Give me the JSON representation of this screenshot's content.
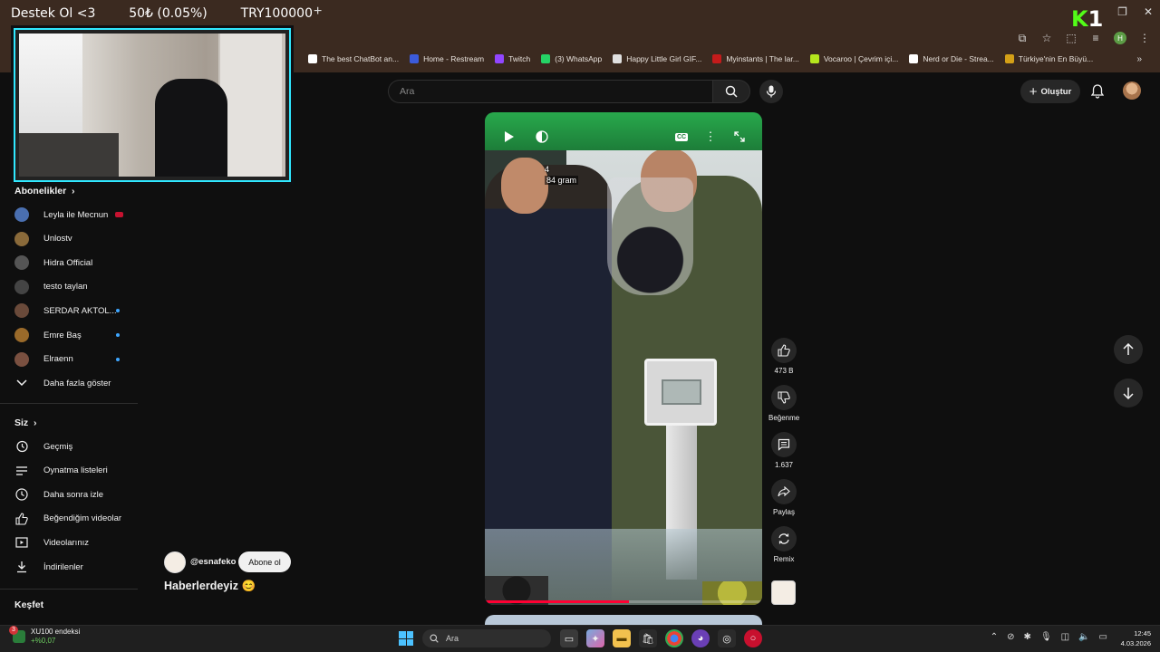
{
  "donation_bar": {
    "label": "Destek Ol <3",
    "amount": "50₺ (0.05%)",
    "goal": "TRY100000"
  },
  "browser": {
    "new_tab": "+",
    "logo_letter": "K",
    "logo_number": "1",
    "bookmarks": [
      {
        "label": "The best ChatBot an...",
        "color": "#ffffff"
      },
      {
        "label": "Home - Restream",
        "color": "#3b5bdb"
      },
      {
        "label": "Twitch",
        "color": "#9146ff"
      },
      {
        "label": "(3) WhatsApp",
        "color": "#25d366"
      },
      {
        "label": "Happy Little Girl GIF...",
        "color": "#e0e0e0"
      },
      {
        "label": "Myinstants | The lar...",
        "color": "#c41b1b"
      },
      {
        "label": "Vocaroo | Çevrim içi...",
        "color": "#b5e61d"
      },
      {
        "label": "Nerd or Die - Strea...",
        "color": "#ffffff"
      },
      {
        "label": "Türkiye'nin En Büyü...",
        "color": "#d4a017"
      }
    ],
    "bookmarks_more": "»",
    "profile_letter": "H"
  },
  "search": {
    "placeholder": "Ara"
  },
  "header": {
    "create_label": "Oluştur"
  },
  "sidebar": {
    "subscriptions_title": "Abonelikler",
    "subscriptions": [
      {
        "label": "Leyla ile Mecnun",
        "color": "#4a6fb0",
        "live": true,
        "dot": false
      },
      {
        "label": "Unlostv",
        "color": "#8a6a3a",
        "live": false,
        "dot": false
      },
      {
        "label": "Hidra Official",
        "color": "#555555",
        "live": false,
        "dot": false
      },
      {
        "label": "testo taylan",
        "color": "#444444",
        "live": false,
        "dot": false
      },
      {
        "label": "SERDAR AKTOL...",
        "color": "#6a4a3a",
        "live": false,
        "dot": true
      },
      {
        "label": "Emre Baş",
        "color": "#9a6a2a",
        "live": false,
        "dot": true
      },
      {
        "label": "Elraenn",
        "color": "#7a5040",
        "live": false,
        "dot": true
      }
    ],
    "show_more": "Daha fazla göster",
    "you_title": "Siz",
    "you_items": [
      {
        "label": "Geçmiş",
        "icon": "history-icon"
      },
      {
        "label": "Oynatma listeleri",
        "icon": "playlists-icon"
      },
      {
        "label": "Daha sonra izle",
        "icon": "watch-later-icon"
      },
      {
        "label": "Beğendiğim videolar",
        "icon": "liked-icon"
      },
      {
        "label": "Videolarınız",
        "icon": "your-videos-icon"
      },
      {
        "label": "İndirilenler",
        "icon": "downloads-icon"
      }
    ],
    "explore_title": "Keşfet"
  },
  "video": {
    "overlay_line1": "4",
    "overlay_line2": "84 gram",
    "progress": 0.52,
    "cc_label": "CC"
  },
  "channel": {
    "name": "@esnafeko",
    "subscribe_label": "Abone ol",
    "title": "Haberlerdeyiz 😊"
  },
  "actions": {
    "like_count": "473 B",
    "dislike_label": "Beğenme",
    "comment_count": "1.637",
    "share_label": "Paylaş",
    "remix_label": "Remix"
  },
  "taskbar": {
    "widget_title": "XU100 endeksi",
    "widget_change": "+%0,07",
    "widget_badge": "3",
    "search_placeholder": "Ara",
    "time": "12:45",
    "date": "4.03.2026"
  }
}
